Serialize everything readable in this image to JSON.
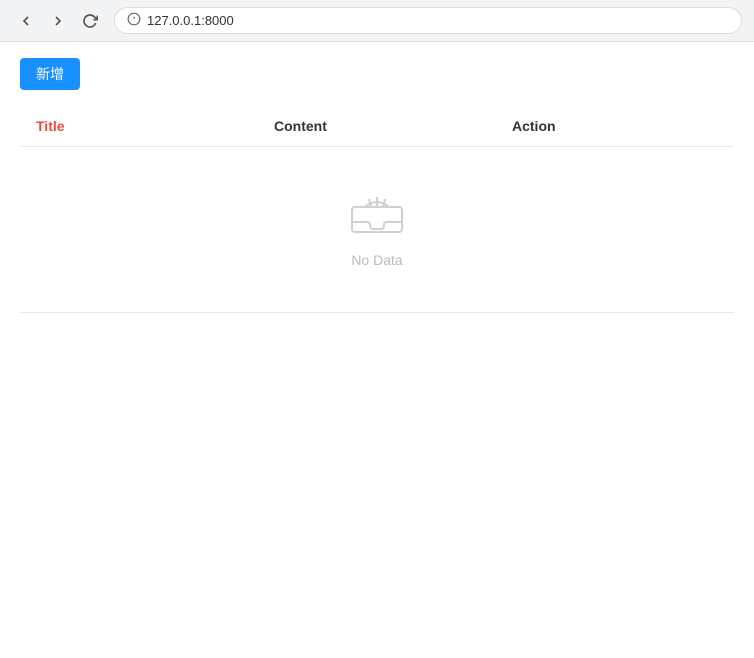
{
  "browser": {
    "url": "127.0.0.1:8000"
  },
  "toolbar": {
    "add_button_label": "新增"
  },
  "table": {
    "columns": [
      {
        "key": "title",
        "label": "Title"
      },
      {
        "key": "content",
        "label": "Content"
      },
      {
        "key": "action",
        "label": "Action"
      }
    ],
    "rows": []
  },
  "empty_state": {
    "text": "No Data"
  },
  "icons": {
    "back": "←",
    "forward": "→",
    "refresh": "↻",
    "info": "ⓘ"
  }
}
